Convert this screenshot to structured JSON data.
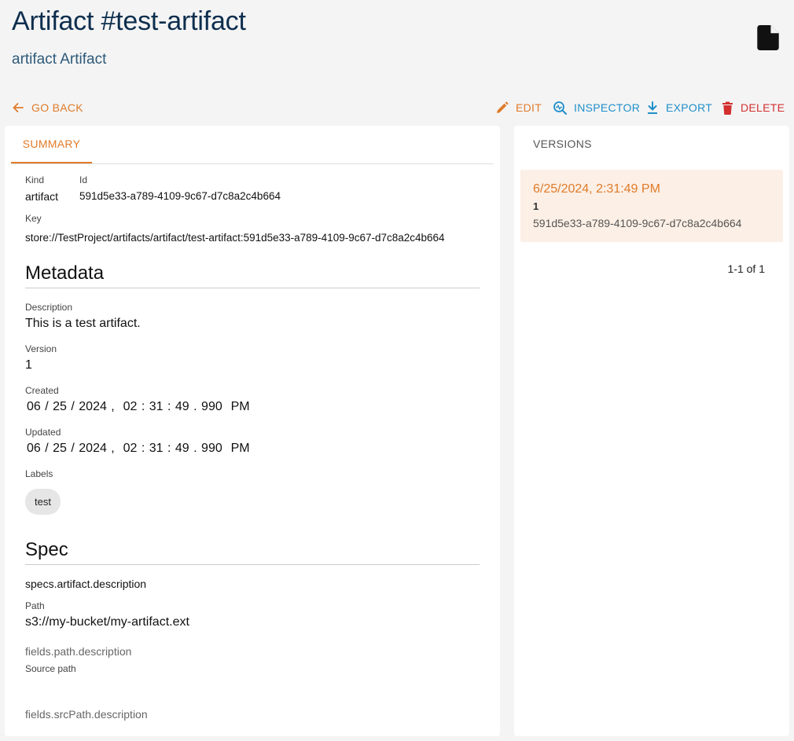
{
  "header": {
    "title": "Artifact #test-artifact",
    "subtitle": "artifact Artifact",
    "icon": "document-icon"
  },
  "toolbar": {
    "go_back": "GO BACK",
    "edit": "EDIT",
    "inspector": "INSPECTOR",
    "export": "EXPORT",
    "delete": "DELETE"
  },
  "colors": {
    "accent": "#e07b2a",
    "info": "#1f8fc9",
    "danger": "#d32f2f",
    "title": "#0d2e4e"
  },
  "summary": {
    "tab_label": "SUMMARY",
    "kind_label": "Kind",
    "kind_value": "artifact",
    "id_label": "Id",
    "id_value": "591d5e33-a789-4109-9c67-d7c8a2c4b664",
    "key_label": "Key",
    "key_value": "store://TestProject/artifacts/artifact/test-artifact:591d5e33-a789-4109-9c67-d7c8a2c4b664"
  },
  "metadata": {
    "title": "Metadata",
    "description_label": "Description",
    "description_value": "This is a test artifact.",
    "version_label": "Version",
    "version_value": "1",
    "created_label": "Created",
    "created_value": "06 / 25 / 2024 ,  02 : 31 : 49 . 990  PM",
    "updated_label": "Updated",
    "updated_value": "06 / 25 / 2024 ,  02 : 31 : 49 . 990  PM",
    "labels_label": "Labels",
    "labels": [
      "test"
    ]
  },
  "spec": {
    "title": "Spec",
    "description": "specs.artifact.description",
    "path_label": "Path",
    "path_value": "s3://my-bucket/my-artifact.ext",
    "path_help": "fields.path.description",
    "src_path_label": "Source path",
    "src_path_help": "fields.srcPath.description"
  },
  "versions": {
    "header": "VERSIONS",
    "items": [
      {
        "date": "6/25/2024, 2:31:49 PM",
        "number": "1",
        "id": "591d5e33-a789-4109-9c67-d7c8a2c4b664"
      }
    ],
    "pagination": "1-1 of 1"
  }
}
